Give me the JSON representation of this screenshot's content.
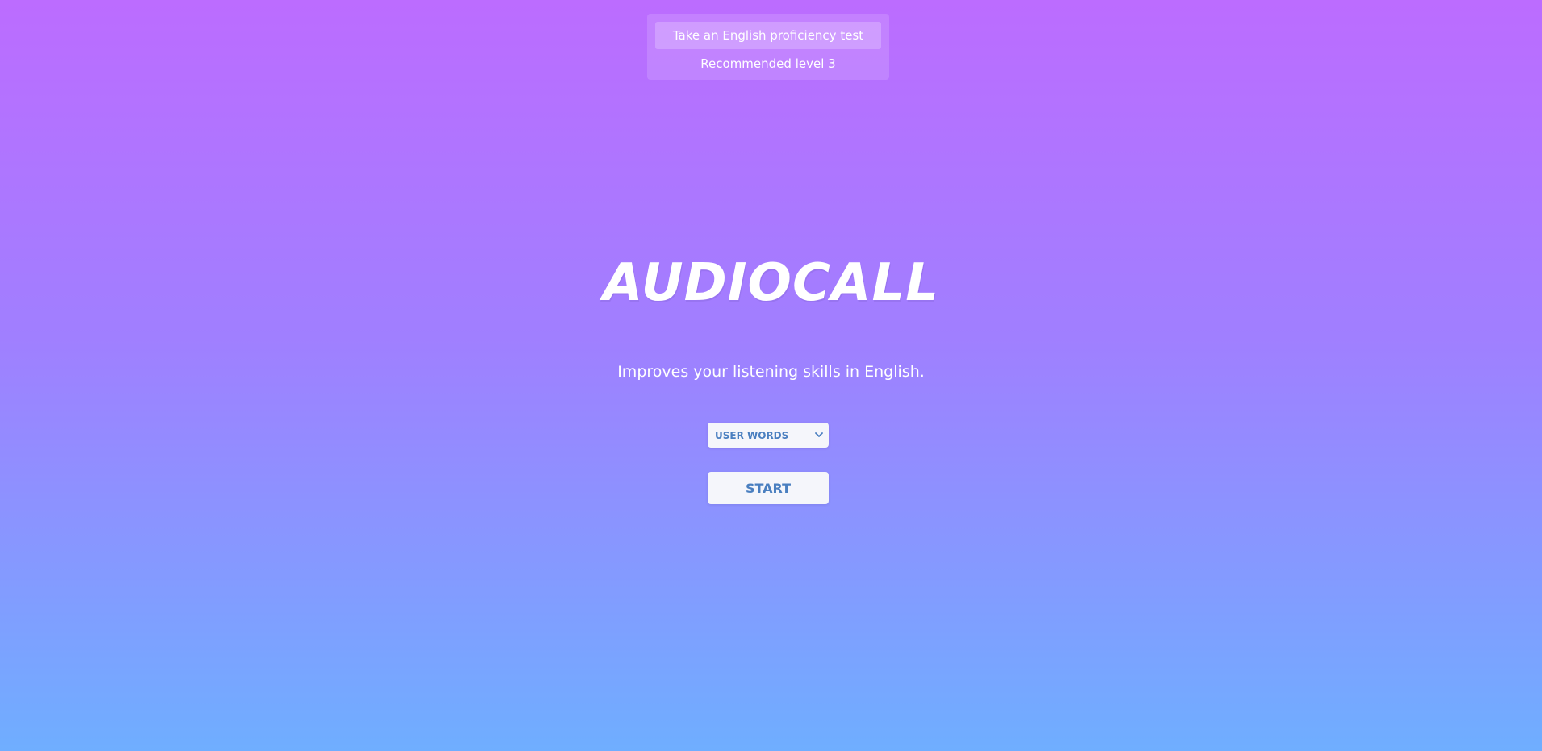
{
  "test_panel": {
    "button_label": "Take an English proficiency test",
    "recommended_text": "Recommended level 3"
  },
  "game": {
    "title": "AUDIOCALL",
    "subtitle": "Improves your listening skills in English.",
    "word_select": {
      "selected": "USER WORDS",
      "icon": "chevron-down-icon"
    },
    "start_label": "START"
  },
  "colors": {
    "gradient_top": "#bc6cff",
    "gradient_middle": "#a07fff",
    "gradient_bottom": "#6faeff",
    "button_background": "#f5f6fb",
    "button_text": "#4a7fc0"
  }
}
